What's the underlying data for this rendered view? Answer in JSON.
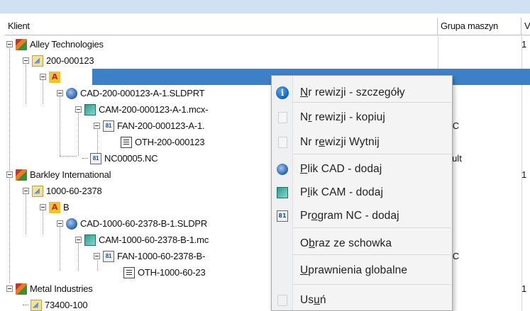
{
  "columns": {
    "client": "Klient",
    "machine_group": "Grupa maszyn",
    "ve": "Ve"
  },
  "tree": [
    {
      "label": "Alley Technologies",
      "icon": "client-icon",
      "col2": "",
      "col3": "1"
    },
    {
      "label": "200-000123",
      "icon": "part-icon",
      "col2": "",
      "col3": ""
    },
    {
      "label": "A",
      "icon": "revision-icon",
      "col2": "",
      "col3": ""
    },
    {
      "label": "CAD-200-000123-A-1.SLDPRT",
      "icon": "cad-icon",
      "col2": "",
      "col3": ""
    },
    {
      "label": "CAM-200-000123-A-1.mcx-",
      "icon": "cam-icon",
      "col2": "",
      "col3": ""
    },
    {
      "label": "FAN-200-000123-A-1.",
      "icon": "nc-icon",
      "col2": "NUC",
      "col3": ""
    },
    {
      "label": "OTH-200-000123",
      "icon": "other-file-icon",
      "col2": "",
      "col3": ""
    },
    {
      "label": "NC00005.NC",
      "icon": "nc-icon",
      "col2": "efault",
      "col3": ""
    },
    {
      "label": "Barkley International",
      "icon": "client-icon",
      "col2": "",
      "col3": "1"
    },
    {
      "label": "1000-60-2378",
      "icon": "part-icon",
      "col2": "",
      "col3": ""
    },
    {
      "label": "B",
      "icon": "revision-icon",
      "col2": "",
      "col3": ""
    },
    {
      "label": "CAD-1000-60-2378-B-1.SLDPR",
      "icon": "cad-icon",
      "col2": "",
      "col3": ""
    },
    {
      "label": "CAM-1000-60-2378-B-1.mc",
      "icon": "cam-icon",
      "col2": "",
      "col3": ""
    },
    {
      "label": "FAN-1000-60-2378-B-",
      "icon": "nc-icon",
      "col2": "NUC",
      "col3": ""
    },
    {
      "label": "OTH-1000-60-23",
      "icon": "other-file-icon",
      "col2": "",
      "col3": ""
    },
    {
      "label": "Metal Industries",
      "icon": "client-icon",
      "col2": "",
      "col3": "1"
    },
    {
      "label": "73400-100",
      "icon": "part-icon",
      "col2": "",
      "col3": ""
    }
  ],
  "menu": {
    "items": [
      {
        "pre": "",
        "u": "N",
        "post": "r rewizji - szczegóły",
        "icon": "info-icon",
        "disabled": false
      },
      {
        "pre": "N",
        "u": "r",
        "post": " rewizji - kopiuj",
        "icon": "copy-icon",
        "disabled": true
      },
      {
        "pre": "Nr r",
        "u": "e",
        "post": "wizji Wytnij",
        "icon": "cut-icon",
        "disabled": true
      },
      {
        "pre": "",
        "u": "P",
        "post": "lik CAD - dodaj",
        "icon": "cad-icon",
        "disabled": false
      },
      {
        "pre": "P",
        "u": "l",
        "post": "ik CAM - dodaj",
        "icon": "cam-icon",
        "disabled": false
      },
      {
        "pre": "Pr",
        "u": "o",
        "post": "gram NC - dodaj",
        "icon": "nc-program-icon",
        "disabled": false
      },
      {
        "pre": "O",
        "u": "b",
        "post": "raz ze schowka",
        "icon": "",
        "disabled": false
      },
      {
        "pre": "",
        "u": "U",
        "post": "prawnienia globalne",
        "icon": "",
        "disabled": false
      },
      {
        "pre": "Us",
        "u": "u",
        "post": "ń",
        "icon": "delete-icon",
        "disabled": true
      }
    ]
  }
}
